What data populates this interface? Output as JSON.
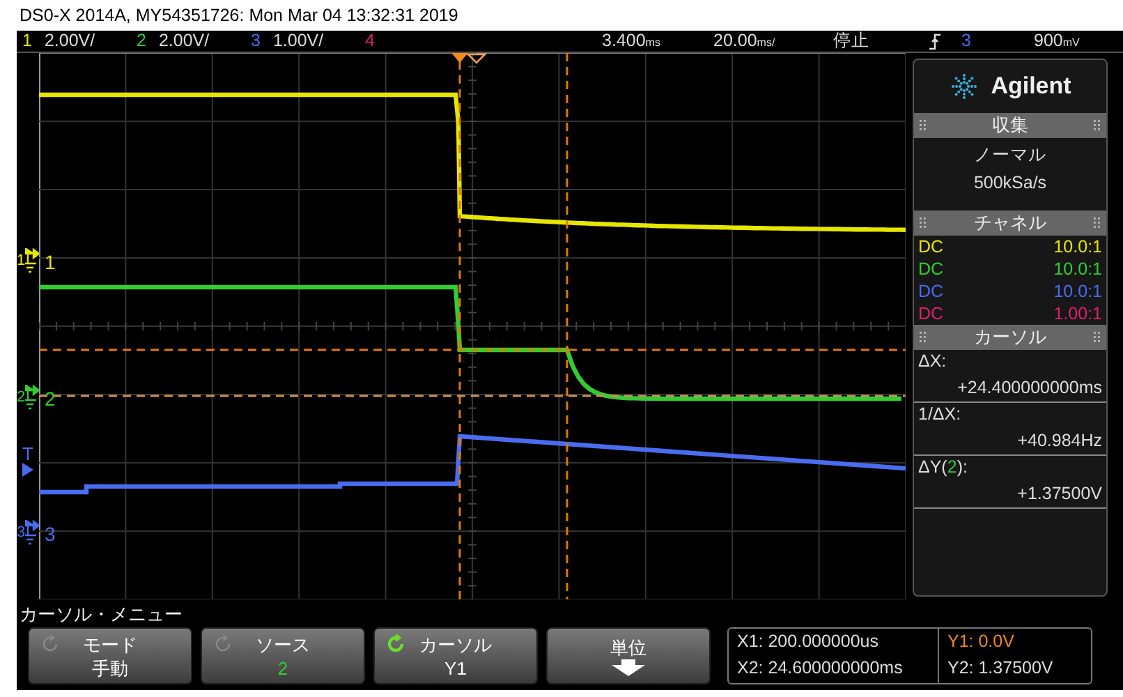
{
  "window": {
    "title": "DS0-X 2014A, MY54351726: Mon Mar 04 13:32:31 2019"
  },
  "status_bar": {
    "channels": [
      {
        "number": "1",
        "scale": "2.00V/",
        "color": "#e6e600"
      },
      {
        "number": "2",
        "scale": "2.00V/",
        "color": "#33cc33"
      },
      {
        "number": "3",
        "scale": "1.00V/",
        "color": "#4a6cf0"
      },
      {
        "number": "4",
        "color": "#e0206a"
      }
    ],
    "delay": {
      "value": "3.400",
      "unit": "ms"
    },
    "timebase": {
      "value": "20.00",
      "unit": "ms/"
    },
    "run_state": "停止",
    "trigger": {
      "source": "3",
      "level": "900",
      "unit": "mV"
    }
  },
  "channel_markers": [
    {
      "kind": "channel",
      "tag": "1",
      "label": "1",
      "color": "#e6e600"
    },
    {
      "kind": "channel",
      "tag": "2",
      "label": "2",
      "color": "#33cc33"
    },
    {
      "kind": "trigger",
      "tag": "T",
      "color": "#4a6cf0"
    },
    {
      "kind": "channel",
      "tag": "3",
      "label": "3",
      "color": "#4a6cf0"
    }
  ],
  "panel": {
    "logo": "Agilent",
    "acquisition": {
      "header": "収集",
      "mode": "ノーマル",
      "rate": "500kSa/s"
    },
    "channels": {
      "header": "チャネル",
      "rows": [
        {
          "coupling": "DC",
          "probe": "10.0:1",
          "color": "#e6e600"
        },
        {
          "coupling": "DC",
          "probe": "10.0:1",
          "color": "#33cc33"
        },
        {
          "coupling": "DC",
          "probe": "10.0:1",
          "color": "#4a6cf0"
        },
        {
          "coupling": "DC",
          "probe": "1.00:1",
          "color": "#e0206a"
        }
      ]
    },
    "cursors": {
      "header": "カーソル",
      "items": [
        {
          "label": "ΔX:",
          "value": "+24.400000000ms"
        },
        {
          "label": "1/ΔX:",
          "value": "+40.984Hz"
        },
        {
          "label": "ΔY(",
          "source": "2",
          "label_end": "):",
          "value": "+1.37500V"
        }
      ]
    }
  },
  "menu": {
    "title": "カーソル・メニュー",
    "softkeys": [
      {
        "kind": "knob",
        "label": "モード",
        "value": "手動",
        "active": false,
        "color": "#ffffff"
      },
      {
        "kind": "knob",
        "label": "ソース",
        "value": "2",
        "active": false,
        "color": "#33cc33"
      },
      {
        "kind": "knob",
        "label": "カーソル",
        "value": "Y1",
        "active": true,
        "color": "#ffffff"
      },
      {
        "kind": "submenu",
        "label": "単位"
      }
    ],
    "readout": [
      {
        "label": "X1:",
        "value": "200.000000us",
        "selected": false
      },
      {
        "label": "X2:",
        "value": "24.600000000ms",
        "selected": false
      },
      {
        "label": "Y1:",
        "value": "0.0V",
        "selected": true
      },
      {
        "label": "Y2:",
        "value": "1.37500V",
        "selected": false
      }
    ]
  }
}
